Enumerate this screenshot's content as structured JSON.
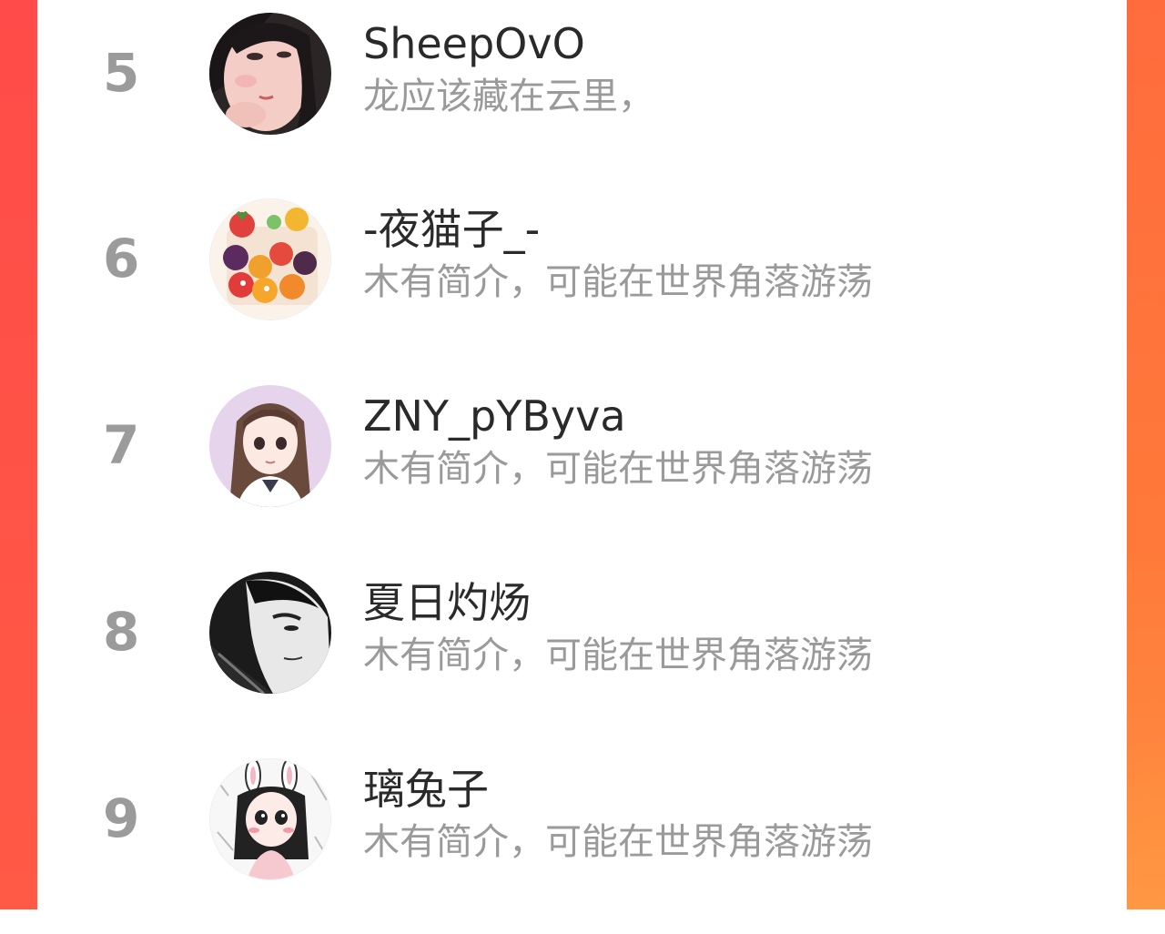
{
  "colors": {
    "accent_left": "#ff4b49",
    "accent_right": "#ff7a3a",
    "rank_gray": "#9b9b9b",
    "name_text": "#2a2a2a",
    "bio_text": "#9a9a9a"
  },
  "ranking": [
    {
      "rank": "5",
      "name": "SheepOvO",
      "bio": "龙应该藏在云里，",
      "avatar": "photo-avatar"
    },
    {
      "rank": "6",
      "name": "-夜猫子_-",
      "bio": "木有简介，可能在世界角落游荡",
      "avatar": "fruit-illustration-avatar"
    },
    {
      "rank": "7",
      "name": "ZNY_pYByva",
      "bio": "木有简介，可能在世界角落游荡",
      "avatar": "anime-girl-avatar"
    },
    {
      "rank": "8",
      "name": "夏日灼炀",
      "bio": "木有简介，可能在世界角落游荡",
      "avatar": "manga-face-avatar"
    },
    {
      "rank": "9",
      "name": "璃兔子",
      "bio": "木有简介，可能在世界角落游荡",
      "avatar": "bunny-girl-avatar"
    }
  ]
}
